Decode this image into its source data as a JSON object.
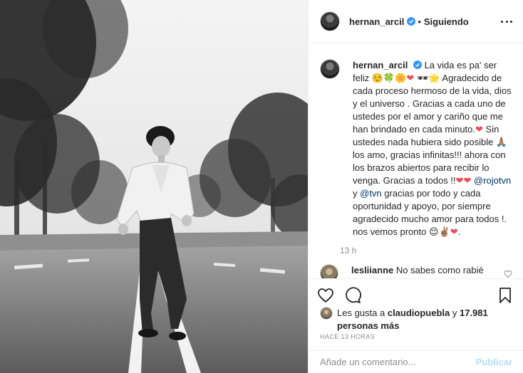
{
  "post": {
    "author": "hernan_arcil",
    "follow_state": "Siguiendo",
    "separator": "•",
    "caption_parts": {
      "intro": "La vida es pa' ser feliz",
      "emojis1": "☺️🍀🌼",
      "emojis2": "🕶🌟 Agradecido de cada proceso hermoso de la vida, dios y el universo . Gracias a cada uno de ustedes por el amor y cariño que me han brindado en cada minuto.",
      "line2": " Sin ustedes nada hubiera sido posible 🙏🏽 los amo, gracias infinitas!!! ahora con los brazos abiertos para recibir lo venga. Gracias a todos !!",
      "mention1": "@rojotvn",
      "connector": " y ",
      "mention2": "@tvn",
      "line3": " gracias por todo y cada oportunidad y apoyo, por siempre agradecido mucho amor para todos !. nos vemos pronto 😌✌🏽",
      "end": "."
    },
    "caption_time": "13 h",
    "comment": {
      "username": "lesliianne",
      "text": "No sabes como rabié cuando te vi en capilla, como putié cuando no t salvaron tus"
    },
    "likes": {
      "prefix": "Les gusta a",
      "user": "claudiopuebla",
      "and": "y",
      "count": "17.981 personas más"
    },
    "posted_ago": "HACE 13 HORAS",
    "add_comment_placeholder": "Añade un comentario...",
    "publish_label": "Publicar"
  },
  "icons": {
    "verified": "verified-badge-icon",
    "more": "more-options-icon",
    "like": "heart-outline-icon",
    "comment": "comment-bubble-icon",
    "save": "bookmark-icon",
    "heart": "❤"
  },
  "colors": {
    "verified": "#3897f0",
    "heart": "#ed4956",
    "mention": "#003569",
    "muted": "#8e8e8e",
    "publish_disabled": "#b2dffc"
  }
}
